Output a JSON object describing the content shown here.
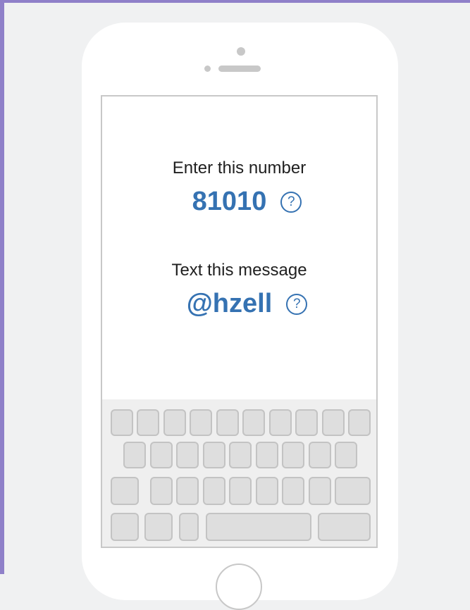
{
  "screen": {
    "number_label": "Enter this number",
    "number_value": "81010",
    "message_label": "Text this message",
    "message_value": "@hzell",
    "help_glyph": "?"
  },
  "icons": {
    "help": "question-circle-icon"
  },
  "colors": {
    "accent": "#3572b2",
    "frame_border": "#8f80c9",
    "background": "#f0f1f2",
    "key_fill": "#dedede",
    "key_border": "#c3c3c3"
  }
}
